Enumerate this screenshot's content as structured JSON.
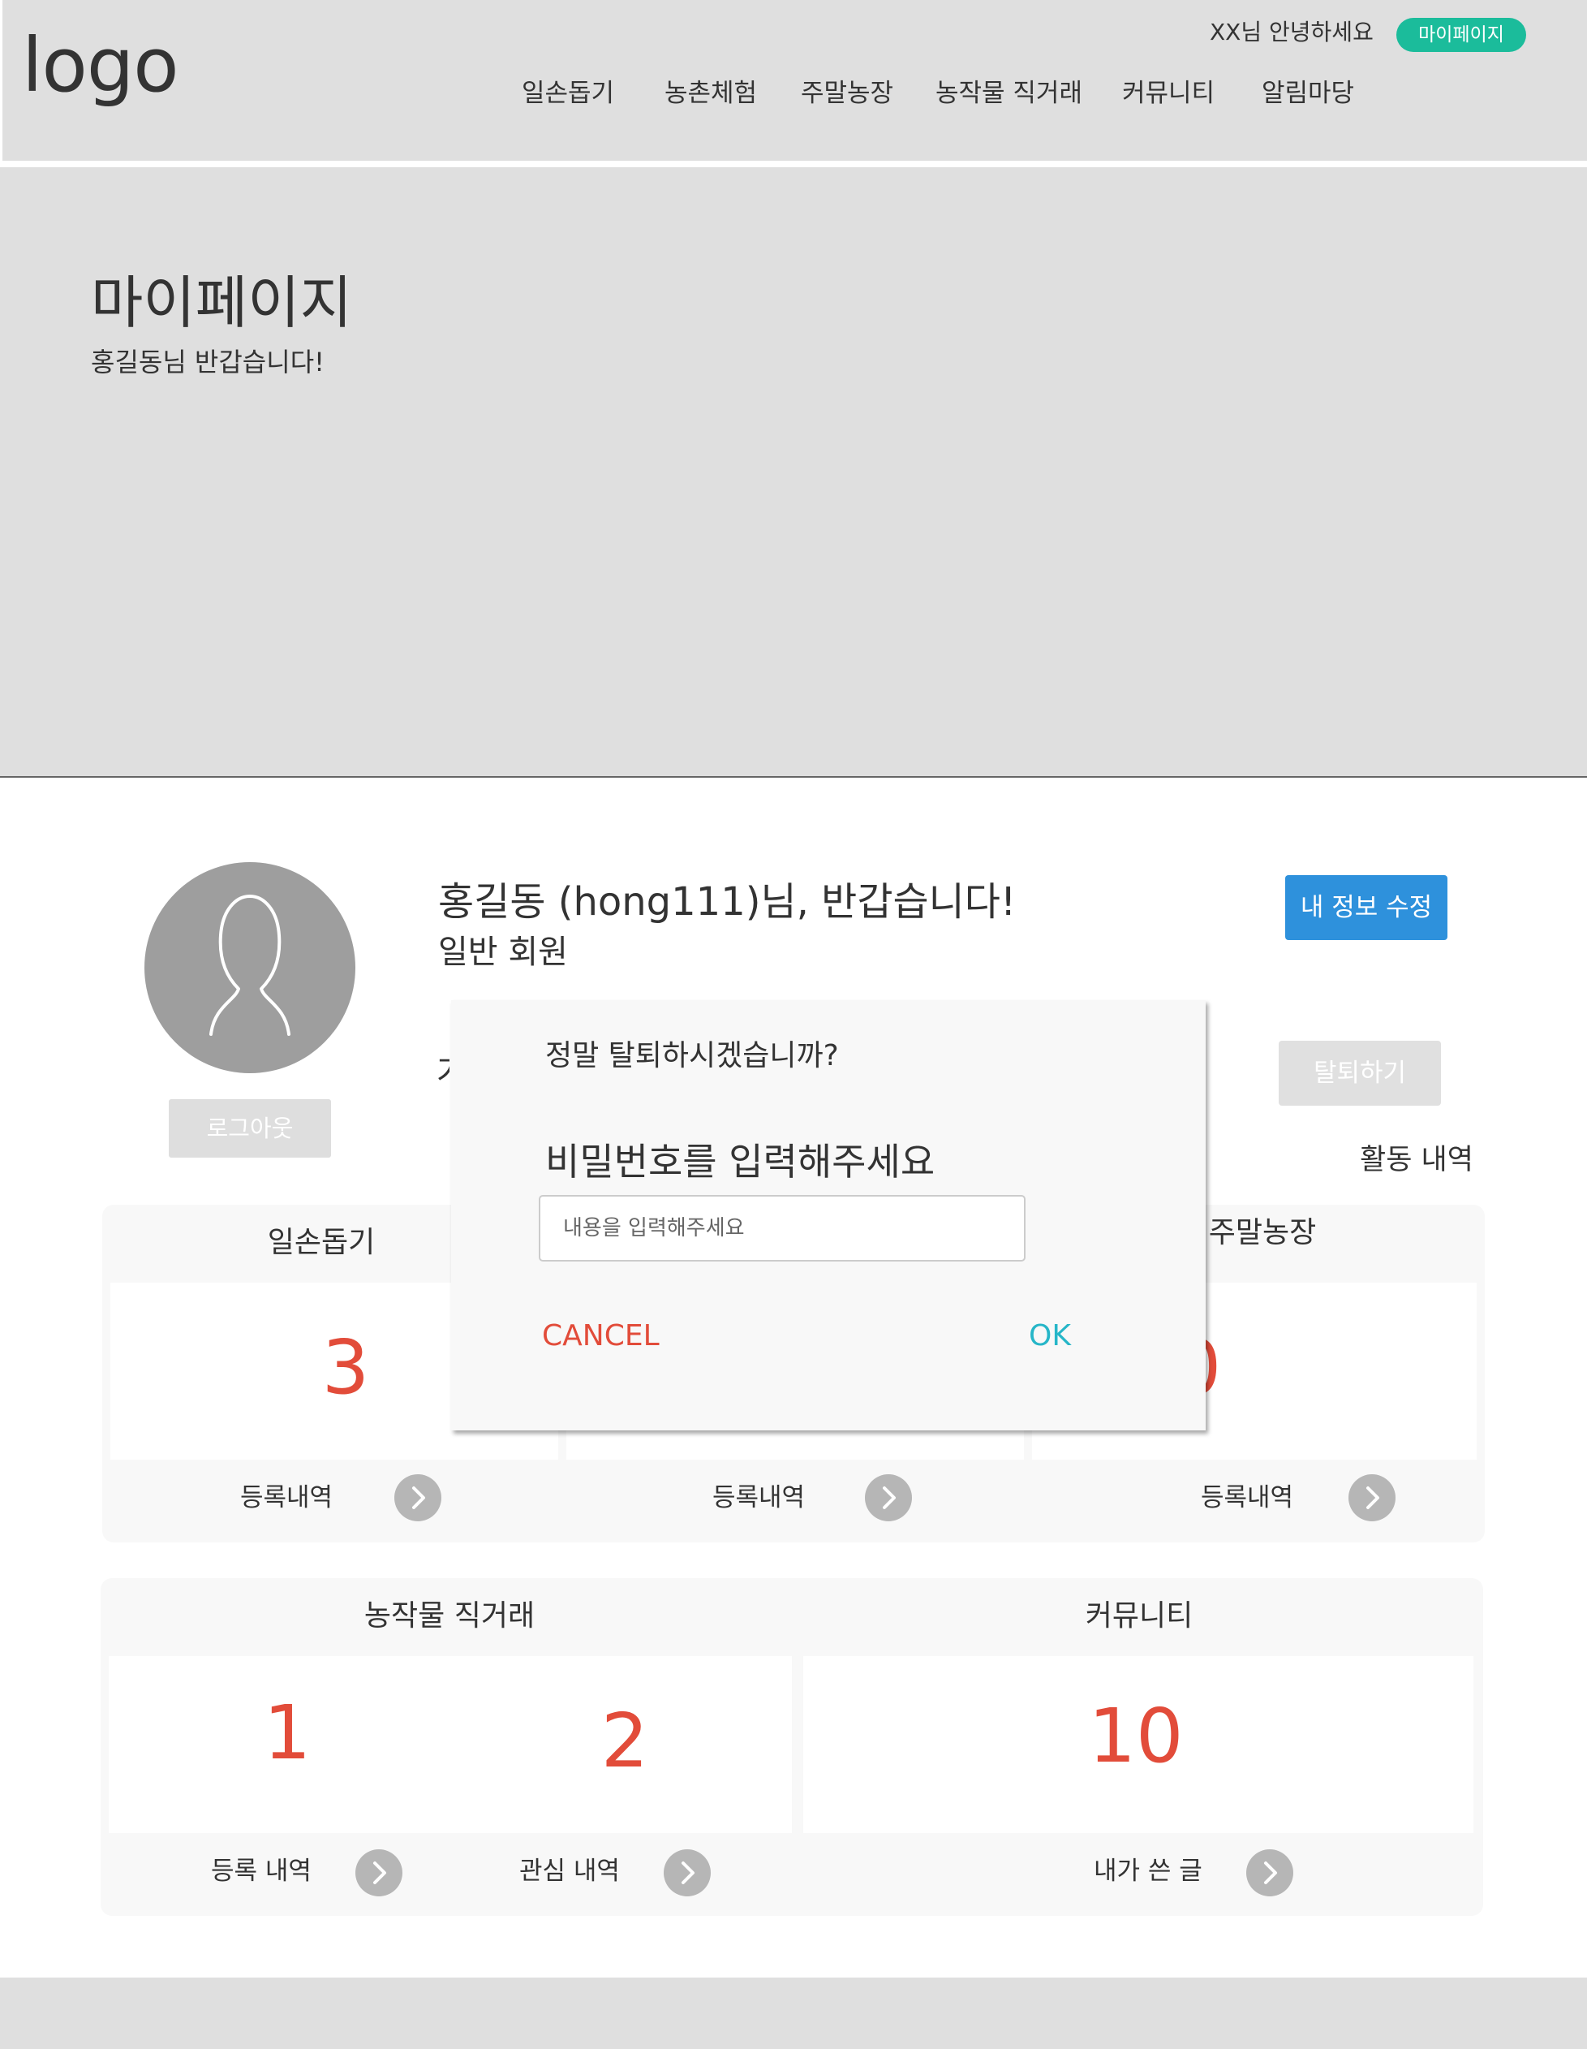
{
  "header": {
    "logo": "logo",
    "greeting": "XX님 안녕하세요",
    "mypage_button": "마이페이지",
    "nav": [
      "일손돕기",
      "농촌체험",
      "주말농장",
      "농작물 직거래",
      "커뮤니티",
      "알림마당"
    ]
  },
  "hero": {
    "title": "마이페이지",
    "subtitle": "홍길동님 반갑습니다!"
  },
  "profile": {
    "name_line": "홍길동 (hong111)님, 반갑습니다!",
    "grade": "일반 회원",
    "partial_char": "가",
    "logout": "로그아웃",
    "edit_info": "내 정보 수정",
    "withdraw": "탈퇴하기",
    "activity_label": "활동 내역"
  },
  "stats_row1": [
    {
      "title": "일손돕기",
      "value": "3",
      "link": "등록내역"
    },
    {
      "title": "",
      "value": "",
      "link": "등록내역"
    },
    {
      "title": "주말농장",
      "value": "0",
      "link": "등록내역"
    }
  ],
  "stats_row2": {
    "trade": {
      "title": "농작물 직거래",
      "registered_value": "1",
      "registered_link": "등록 내역",
      "interest_value": "2",
      "interest_link": "관심 내역"
    },
    "community": {
      "title": "커뮤니티",
      "value": "10",
      "link": "내가 쓴 글"
    }
  },
  "modal": {
    "question": "정말 탈퇴하시겠습니까?",
    "prompt": "비밀번호를 입력해주세요",
    "input_placeholder": "내용을 입력해주세요",
    "input_value": "",
    "cancel": "CANCEL",
    "ok": "OK"
  },
  "colors": {
    "accent_green": "#1bbc9b",
    "edit_blue": "#2e91dc",
    "number_red": "#e24c3a",
    "ok_teal": "#26b6c8"
  }
}
